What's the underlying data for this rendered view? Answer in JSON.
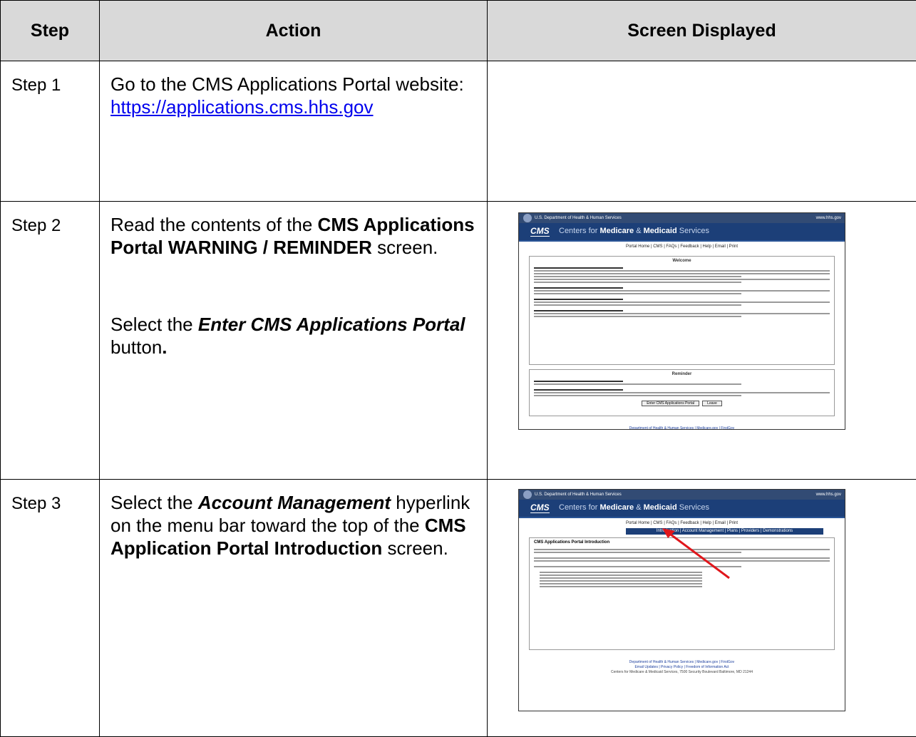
{
  "headers": {
    "step": "Step",
    "action": "Action",
    "screen": "Screen Displayed"
  },
  "rows": [
    {
      "step": "Step 1",
      "text1": "Go to the CMS Applications Portal website:",
      "link": "https://applications.cms.hhs.gov"
    },
    {
      "step": "Step 2",
      "p1_pre": "Read the contents of the ",
      "p1_bold": "CMS Applications Portal WARNING / REMINDER",
      "p1_post": " screen.",
      "p2_pre": "Select the ",
      "p2_boldital": "Enter CMS Applications Portal",
      "p2_post": " button",
      "p2_end": "."
    },
    {
      "step": "Step 3",
      "pre": "Select the ",
      "boldital": "Account Management",
      "mid": " hyperlink on the menu bar toward the top of the ",
      "bold": "CMS Application Portal Introduction",
      "post": " screen."
    }
  ],
  "thumb": {
    "hhs": "U.S. Department of Health & Human Services",
    "gov": "www.hhs.gov",
    "logo": "CMS",
    "name_pre": "Centers for ",
    "name_b1": "Medicare",
    "name_mid": " & ",
    "name_b2": "Medicaid",
    "name_post": " Services",
    "nav": "Portal Home | CMS | FAQs | Feedback | Help | Email | Print",
    "subnav": "Introduction | Account Management | Plans | Providers | Demonstrations",
    "warning_title": "Welcome",
    "reminder_title": "Reminder",
    "enter_btn": "Enter CMS Applications Portal",
    "leave_btn": "Leave",
    "intro_title": "CMS Applications Portal Introduction",
    "footer_links": "Department of Health & Human Services | Medicare.gov | FirstGov",
    "footer_links2": "Email Updates | Privacy Policy | Freedom of Information Act",
    "footer_addr": "Centers for Medicare & Medicaid Services, 7500 Security Boulevard Baltimore, MD 21244"
  }
}
